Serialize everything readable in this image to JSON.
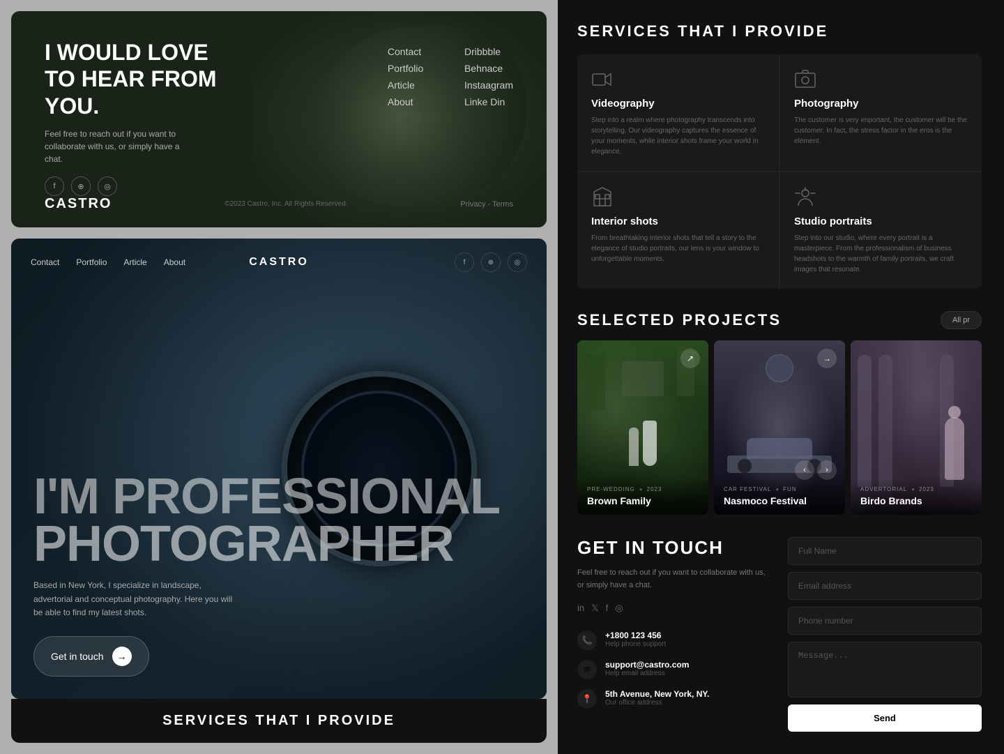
{
  "brand": "CASTRO",
  "top_card": {
    "headline": "I WOULD LOVE TO HEAR FROM YOU.",
    "subtext": "Feel free to reach out if you want to collaborate with us, or simply have a chat.",
    "nav": [
      "Contact",
      "Portfolio",
      "Article",
      "About",
      "Dribbble",
      "Behnace",
      "Instaagram",
      "Linke Din"
    ],
    "footer_copyright": "©2023 Castro, Inc. All Rights Reserved.",
    "footer_links": "Privacy - Terms"
  },
  "bottom_card": {
    "nav_links": [
      "Contact",
      "Portfolio",
      "Article",
      "About"
    ],
    "hero_line1": "I'M PROFESSIONAL",
    "hero_line2": "PHOTOGRAPHER",
    "subtitle": "Based in New York, I specialize in landscape, advertorial and conceptual photography. Here you will be able to find my latest shots.",
    "cta_label": "Get in touch"
  },
  "services_bottom_title": "SERVICES THAT I PROVIDE",
  "right_panel": {
    "services_title": "SERVICES THAT I PROVIDE",
    "services": [
      {
        "name": "Videography",
        "desc": "Step into a realm where photography transcends into storytelling. Our videography captures the essence of your moments, while interior shots frame your world in elegance."
      },
      {
        "name": "Photography",
        "desc": "The customer is very important, the customer will be the customer. In fact, the stress factor in the eros is the element."
      },
      {
        "name": "Interior shots",
        "desc": "From breathtaking interior shots that tell a story to the elegance of studio portraits, our lens is your window to unforgettable moments."
      },
      {
        "name": "Studio portraits",
        "desc": "Step into our studio, where every portrait is a masterpiece. From the professionalism of business headshots to the warmth of family portraits, we craft images that resonate."
      }
    ],
    "projects_title": "SELECTED PROJECTS",
    "all_projects_label": "All pr",
    "projects": [
      {
        "name": "Brown Family",
        "tags": [
          "PRE-WEDDING",
          "2023"
        ],
        "tag_separator": "●"
      },
      {
        "name": "Nasmoco Festival",
        "tags": [
          "CAR FESTIVAL",
          "FUN"
        ],
        "tag_separator": "●"
      },
      {
        "name": "Birdo Brands",
        "tags": [
          "ADVERTORIAL",
          "2023"
        ],
        "tag_separator": "●"
      }
    ],
    "contact_title": "GET IN TOUCH",
    "contact_subtext": "Feel free to reach out if you want to collaborate with us, or simply have a chat.",
    "contact_info": [
      {
        "icon": "📞",
        "label": "+1800 123 456",
        "sublabel": "Help phone support"
      },
      {
        "icon": "✉",
        "label": "support@castro.com",
        "sublabel": "Help email address"
      },
      {
        "icon": "📍",
        "label": "5th Avenue, New York, NY.",
        "sublabel": "Our office address"
      }
    ],
    "form": {
      "full_name_placeholder": "Full Name",
      "email_placeholder": "Email address",
      "phone_placeholder": "Phone number",
      "message_placeholder": "Message...",
      "send_label": "Send"
    }
  }
}
